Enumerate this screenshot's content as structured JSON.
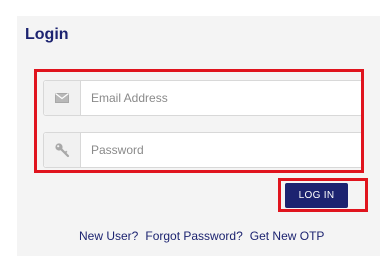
{
  "login": {
    "title": "Login",
    "email": {
      "placeholder": "Email Address",
      "value": ""
    },
    "password": {
      "placeholder": "Password",
      "value": ""
    },
    "submit_label": "LOG IN",
    "links": [
      "New User?",
      "Forgot Password?",
      "Get New OTP"
    ]
  },
  "icons": {
    "email": "envelope-icon",
    "password": "key-icon"
  },
  "colors": {
    "brand": "#1c2370",
    "highlight": "#e0141e",
    "panel": "#f4f4f4"
  }
}
